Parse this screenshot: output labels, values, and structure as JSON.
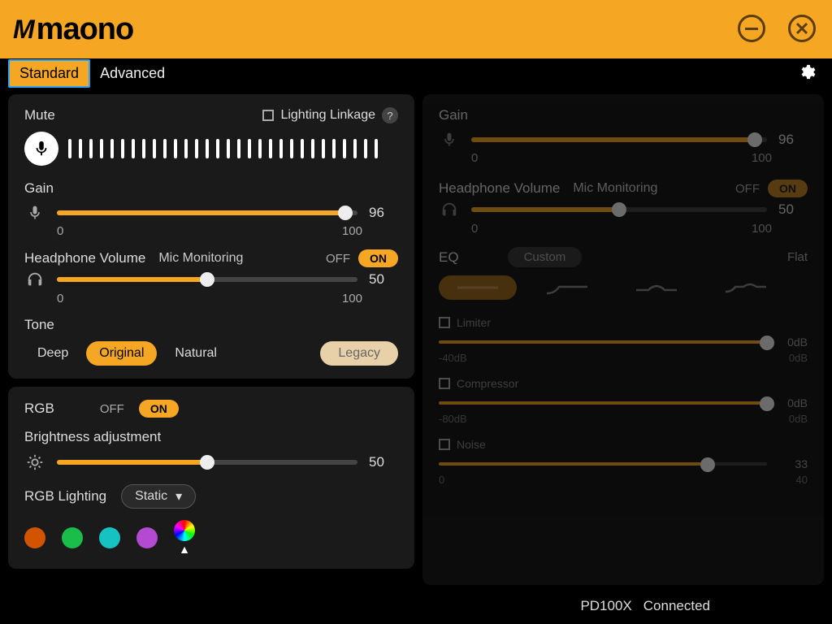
{
  "brand": "maono",
  "tabs": {
    "standard": "Standard",
    "advanced": "Advanced"
  },
  "mute": {
    "label": "Mute",
    "linkage": "Lighting Linkage",
    "help": "?"
  },
  "gain": {
    "label": "Gain",
    "value": "96",
    "min": "0",
    "max": "100"
  },
  "headphone": {
    "label": "Headphone Volume",
    "monitoring": "Mic Monitoring",
    "off": "OFF",
    "on": "ON",
    "value": "50",
    "min": "0",
    "max": "100"
  },
  "tone": {
    "label": "Tone",
    "deep": "Deep",
    "original": "Original",
    "natural": "Natural",
    "legacy": "Legacy"
  },
  "rgb": {
    "label": "RGB",
    "off": "OFF",
    "on": "ON",
    "brightness_label": "Brightness adjustment",
    "brightness_value": "50",
    "lighting_label": "RGB Lighting",
    "mode": "Static"
  },
  "colors": {
    "c1": "#d35400",
    "c2": "#1abc4a",
    "c3": "#17c2c2",
    "c4": "#b34ad1"
  },
  "adv": {
    "gain": {
      "label": "Gain",
      "value": "96",
      "min": "0",
      "max": "100"
    },
    "hp": {
      "label": "Headphone Volume",
      "monitoring": "Mic Monitoring",
      "off": "OFF",
      "on": "ON",
      "value": "50",
      "min": "0",
      "max": "100"
    },
    "eq": {
      "label": "EQ",
      "custom": "Custom",
      "flat": "Flat"
    },
    "limiter": {
      "label": "Limiter",
      "value": "0dB",
      "min": "-40dB",
      "max": "0dB"
    },
    "compressor": {
      "label": "Compressor",
      "value": "0dB",
      "min": "-80dB",
      "max": "0dB"
    },
    "noise": {
      "label": "Noise",
      "value": "33",
      "min": "0",
      "max": "40"
    }
  },
  "status": {
    "device": "PD100X",
    "state": "Connected"
  }
}
